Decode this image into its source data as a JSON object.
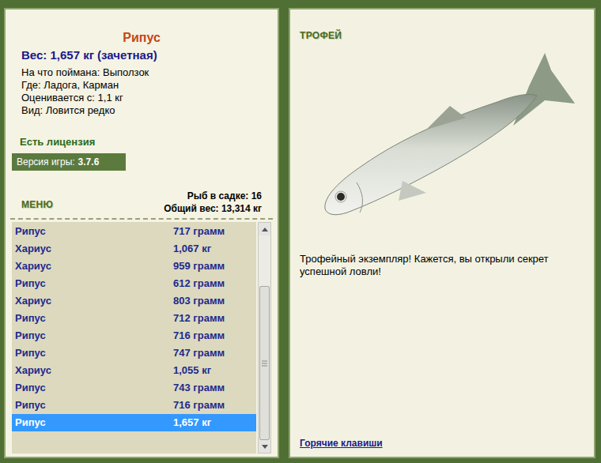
{
  "fish": {
    "name": "Рипус",
    "weight": "Вес: 1,657 кг (зачетная)",
    "details": [
      "На что поймана: Выползок",
      "Где: Ладога, Карман",
      "Оценивается с: 1,1 кг",
      "Вид: Ловится редко"
    ]
  },
  "license": "Есть лицензия",
  "version": {
    "label": "Версия игры:",
    "value": "3.7.6"
  },
  "menu": "МЕНЮ",
  "keepnet": {
    "count": "Рыб в садке: 16",
    "total": "Общий вес: 13,314 кг"
  },
  "catch_list": [
    {
      "name": "Рипус",
      "weight": "717 грамм",
      "selected": false
    },
    {
      "name": "Хариус",
      "weight": "1,067 кг",
      "selected": false
    },
    {
      "name": "Хариус",
      "weight": "959 грамм",
      "selected": false
    },
    {
      "name": "Рипус",
      "weight": "612 грамм",
      "selected": false
    },
    {
      "name": "Хариус",
      "weight": "803 грамм",
      "selected": false
    },
    {
      "name": "Рипус",
      "weight": "712 грамм",
      "selected": false
    },
    {
      "name": "Рипус",
      "weight": "716 грамм",
      "selected": false
    },
    {
      "name": "Рипус",
      "weight": "747 грамм",
      "selected": false
    },
    {
      "name": "Хариус",
      "weight": "1,055 кг",
      "selected": false
    },
    {
      "name": "Рипус",
      "weight": "743 грамм",
      "selected": false
    },
    {
      "name": "Рипус",
      "weight": "716 грамм",
      "selected": false
    },
    {
      "name": "Рипус",
      "weight": "1,657 кг",
      "selected": true
    }
  ],
  "scrollbar": {
    "level": 1
  },
  "trophy": {
    "badge": "ТРОФЕЙ",
    "message": "Трофейный экземпляр! Кажется, вы открыли секрет успешной ловли!"
  },
  "hotkeys": "Горячие клавиши"
}
